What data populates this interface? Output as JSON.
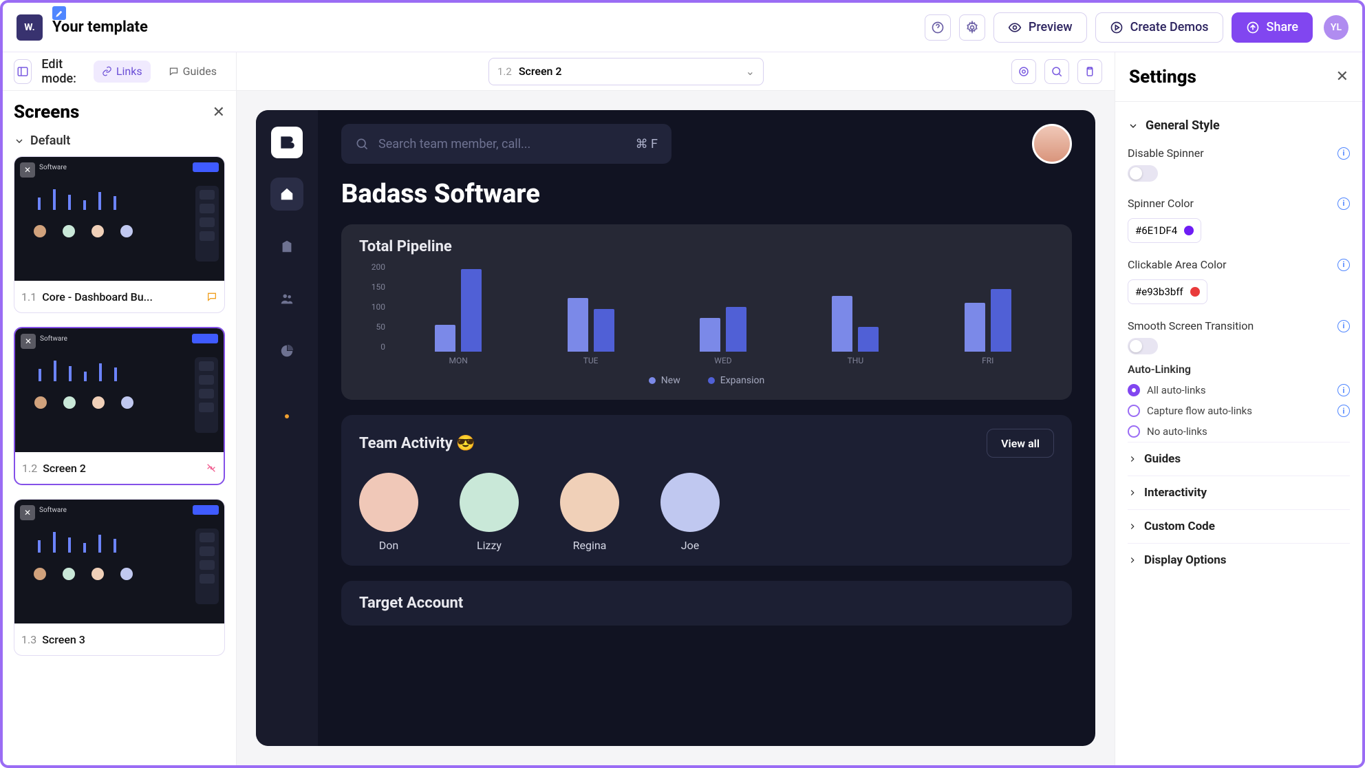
{
  "header": {
    "logo": "W.",
    "title": "Your template",
    "preview_label": "Preview",
    "create_demos_label": "Create Demos",
    "share_label": "Share",
    "avatar_initials": "YL"
  },
  "editbar": {
    "edit_mode_label": "Edit mode:",
    "links_label": "Links",
    "guides_label": "Guides"
  },
  "screens_panel": {
    "title": "Screens",
    "group_label": "Default",
    "items": [
      {
        "num": "1.1",
        "name": "Core - Dashboard Bu...",
        "has_tag": true,
        "has_broken": false
      },
      {
        "num": "1.2",
        "name": "Screen 2",
        "has_tag": false,
        "has_broken": true
      },
      {
        "num": "1.3",
        "name": "Screen 3",
        "has_tag": false,
        "has_broken": false
      }
    ],
    "active_index": 1
  },
  "canvas_toolbar": {
    "selected_num": "1.2",
    "selected_name": "Screen 2"
  },
  "mock": {
    "search_placeholder": "Search team member, call...",
    "search_shortcut": "⌘ F",
    "heading": "Badass Software",
    "pipeline_title": "Total Pipeline",
    "team_title": "Team Activity 😎",
    "view_all_label": "View all",
    "members": [
      {
        "name": "Don",
        "bg": "#f0c8b8"
      },
      {
        "name": "Lizzy",
        "bg": "#c9e8d8"
      },
      {
        "name": "Regina",
        "bg": "#f0d0b8"
      },
      {
        "name": "Joe",
        "bg": "#c0c8f0"
      }
    ],
    "target_title": "Target Account"
  },
  "chart_data": {
    "type": "bar",
    "categories": [
      "MON",
      "TUE",
      "WED",
      "THU",
      "FRI"
    ],
    "series": [
      {
        "name": "New",
        "color": "#7b89e8",
        "values": [
          60,
          120,
          75,
          125,
          110
        ]
      },
      {
        "name": "Expansion",
        "color": "#5060d6",
        "values": [
          185,
          95,
          100,
          55,
          140
        ]
      }
    ],
    "title": "Total Pipeline",
    "xlabel": "",
    "ylabel": "",
    "ylim": [
      0,
      200
    ],
    "y_ticks": [
      200,
      150,
      100,
      50,
      0
    ]
  },
  "settings": {
    "title": "Settings",
    "general_label": "General Style",
    "disable_spinner_label": "Disable Spinner",
    "spinner_color_label": "Spinner Color",
    "spinner_color_value": "#6E1DF4",
    "clickable_color_label": "Clickable Area Color",
    "clickable_color_value": "#e93b3bff",
    "smooth_label": "Smooth Screen Transition",
    "autolink_label": "Auto-Linking",
    "autolink_options": [
      {
        "label": "All auto-links",
        "checked": true,
        "info": true
      },
      {
        "label": "Capture flow auto-links",
        "checked": false,
        "info": true
      },
      {
        "label": "No auto-links",
        "checked": false,
        "info": false
      }
    ],
    "sections": [
      "Guides",
      "Interactivity",
      "Custom Code",
      "Display Options"
    ]
  }
}
